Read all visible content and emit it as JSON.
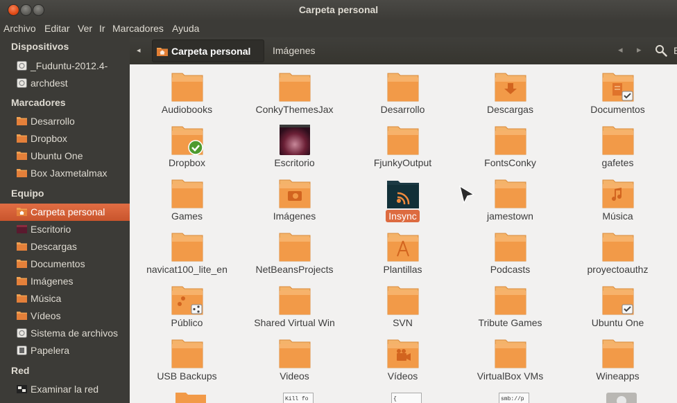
{
  "window": {
    "title": "Carpeta personal"
  },
  "menubar": [
    "Archivo",
    "Editar",
    "Ver",
    "Ir",
    "Marcadores",
    "Ayuda"
  ],
  "sidebar": {
    "sections": [
      {
        "heading": "Dispositivos",
        "items": [
          {
            "label": "_Fuduntu-2012.4-",
            "icon": "drive-icon"
          },
          {
            "label": "archdest",
            "icon": "drive-icon"
          }
        ]
      },
      {
        "heading": "Marcadores",
        "items": [
          {
            "label": "Desarrollo",
            "icon": "folder-icon"
          },
          {
            "label": "Dropbox",
            "icon": "folder-icon"
          },
          {
            "label": "Ubuntu One",
            "icon": "folder-icon"
          },
          {
            "label": "Box Jaxmetalmax",
            "icon": "folder-icon"
          }
        ]
      },
      {
        "heading": "Equipo",
        "items": [
          {
            "label": "Carpeta personal",
            "icon": "home-folder-icon",
            "active": true
          },
          {
            "label": "Escritorio",
            "icon": "desktop-icon"
          },
          {
            "label": "Descargas",
            "icon": "folder-icon"
          },
          {
            "label": "Documentos",
            "icon": "folder-icon"
          },
          {
            "label": "Imágenes",
            "icon": "folder-icon"
          },
          {
            "label": "Música",
            "icon": "folder-icon"
          },
          {
            "label": "Vídeos",
            "icon": "folder-icon"
          },
          {
            "label": "Sistema de archivos",
            "icon": "drive-icon"
          },
          {
            "label": "Papelera",
            "icon": "trash-icon"
          }
        ]
      },
      {
        "heading": "Red",
        "items": [
          {
            "label": "Examinar la red",
            "icon": "network-icon"
          }
        ]
      }
    ]
  },
  "toolbar": {
    "back_arrow": "◂",
    "breadcrumb_active": "Carpeta personal",
    "breadcrumb_next": "Imágenes",
    "prev_arrow": "◂",
    "next_arrow": "▸",
    "view_label": "E"
  },
  "files": [
    {
      "name": "Audiobooks",
      "emblem": ""
    },
    {
      "name": "ConkyThemesJax",
      "emblem": ""
    },
    {
      "name": "Desarrollo",
      "emblem": ""
    },
    {
      "name": "Descargas",
      "emblem": "download"
    },
    {
      "name": "Documentos",
      "emblem": "document-check"
    },
    {
      "name": "Dropbox",
      "emblem": "green-check"
    },
    {
      "name": "Escritorio",
      "emblem": "desktop"
    },
    {
      "name": "FjunkyOutput",
      "emblem": ""
    },
    {
      "name": "FontsConky",
      "emblem": ""
    },
    {
      "name": "gafetes",
      "emblem": ""
    },
    {
      "name": "Games",
      "emblem": ""
    },
    {
      "name": "Imágenes",
      "emblem": "camera"
    },
    {
      "name": "Insync",
      "emblem": "insync",
      "selected": true
    },
    {
      "name": "jamestown",
      "emblem": ""
    },
    {
      "name": "Música",
      "emblem": "music"
    },
    {
      "name": "navicat100_lite_en",
      "emblem": ""
    },
    {
      "name": "NetBeansProjects",
      "emblem": ""
    },
    {
      "name": "Plantillas",
      "emblem": "template"
    },
    {
      "name": "Podcasts",
      "emblem": ""
    },
    {
      "name": "proyectoauthz",
      "emblem": ""
    },
    {
      "name": "Público",
      "emblem": "share"
    },
    {
      "name": "Shared Virtual Win",
      "emblem": ""
    },
    {
      "name": "SVN",
      "emblem": ""
    },
    {
      "name": "Tribute Games",
      "emblem": ""
    },
    {
      "name": "Ubuntu One",
      "emblem": "check"
    },
    {
      "name": "USB Backups",
      "emblem": ""
    },
    {
      "name": "Videos",
      "emblem": ""
    },
    {
      "name": "Vídeos",
      "emblem": "film"
    },
    {
      "name": "VirtualBox VMs",
      "emblem": ""
    },
    {
      "name": "Wineapps",
      "emblem": ""
    }
  ],
  "partial_row": [
    {
      "kind": "folder",
      "text": ""
    },
    {
      "kind": "text-file",
      "text": "Kill fo"
    },
    {
      "kind": "text-file",
      "text": "{"
    },
    {
      "kind": "text-file",
      "text": "smb://p"
    },
    {
      "kind": "settings-file",
      "text": ""
    }
  ],
  "colors": {
    "accent": "#dd6b40",
    "folder": "#f2a453",
    "sidebar_bg": "#3c3b37",
    "content_bg": "#f2f1f0"
  }
}
